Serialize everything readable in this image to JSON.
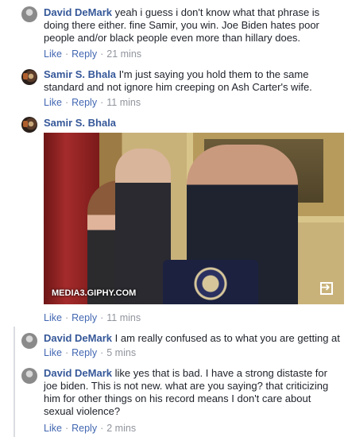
{
  "comments": [
    {
      "author": "David DeMark",
      "text": "yeah i guess i don't know what that phrase is doing there either. fine Samir, you win. Joe Biden hates poor people and/or black people even more than hillary does.",
      "like": "Like",
      "reply": "Reply",
      "time": "21 mins"
    },
    {
      "author": "Samir S. Bhala",
      "text": "I'm just saying you hold them to the same standard and not ignore him creeping on Ash Carter's wife.",
      "like": "Like",
      "reply": "Reply",
      "time": "11 mins"
    },
    {
      "author": "Samir S. Bhala",
      "text": "",
      "like": "Like",
      "reply": "Reply",
      "time": "11 mins",
      "gif_source": "MEDIA3.GIPHY.COM"
    },
    {
      "author": "David DeMark",
      "text": "I am really confused as to what you are getting at",
      "like": "Like",
      "reply": "Reply",
      "time": "5 mins"
    },
    {
      "author": "David DeMark",
      "text": "like yes that is bad. I have a strong distaste for joe biden. This is not new. what are you saying? that criticizing him for other things on his record means I don't care about sexual violence?",
      "like": "Like",
      "reply": "Reply",
      "time": "2 mins"
    }
  ],
  "separator": "·",
  "icons": {
    "david_avatar": "avatar-gray",
    "samir_avatar": "avatar-dark",
    "gif_expand": "expand-icon"
  }
}
